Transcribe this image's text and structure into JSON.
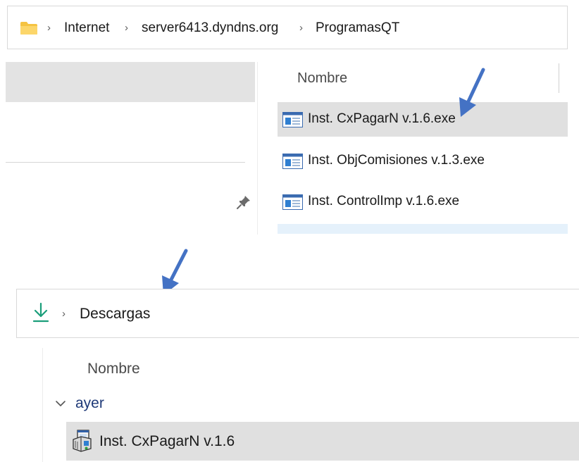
{
  "top_window": {
    "breadcrumb": [
      "Internet",
      "server6413.dyndns.org",
      "ProgramasQT"
    ],
    "breadcrumb_separator": "›",
    "column_header": "Nombre",
    "files": [
      {
        "name": "Inst. CxPagarN v.1.6.exe",
        "selected": true,
        "icon": "application-window-icon"
      },
      {
        "name": "Inst. ObjComisiones v.1.3.exe",
        "selected": false,
        "icon": "application-window-icon"
      },
      {
        "name": "Inst. ControlImp v.1.6.exe",
        "selected": false,
        "icon": "application-window-icon"
      }
    ]
  },
  "bottom_window": {
    "breadcrumb": [
      "Descargas"
    ],
    "breadcrumb_separator": "›",
    "column_header": "Nombre",
    "group": {
      "label": "ayer",
      "expanded": true
    },
    "files": [
      {
        "name": "Inst. CxPagarN v.1.6",
        "selected": true,
        "icon": "installer-icon"
      }
    ]
  },
  "colors": {
    "arrow": "#4472c4",
    "selection": "#e0e0e0",
    "folder": "#f5c342",
    "download_icon": "#1a9e7a",
    "group_label": "#1f3a78"
  }
}
